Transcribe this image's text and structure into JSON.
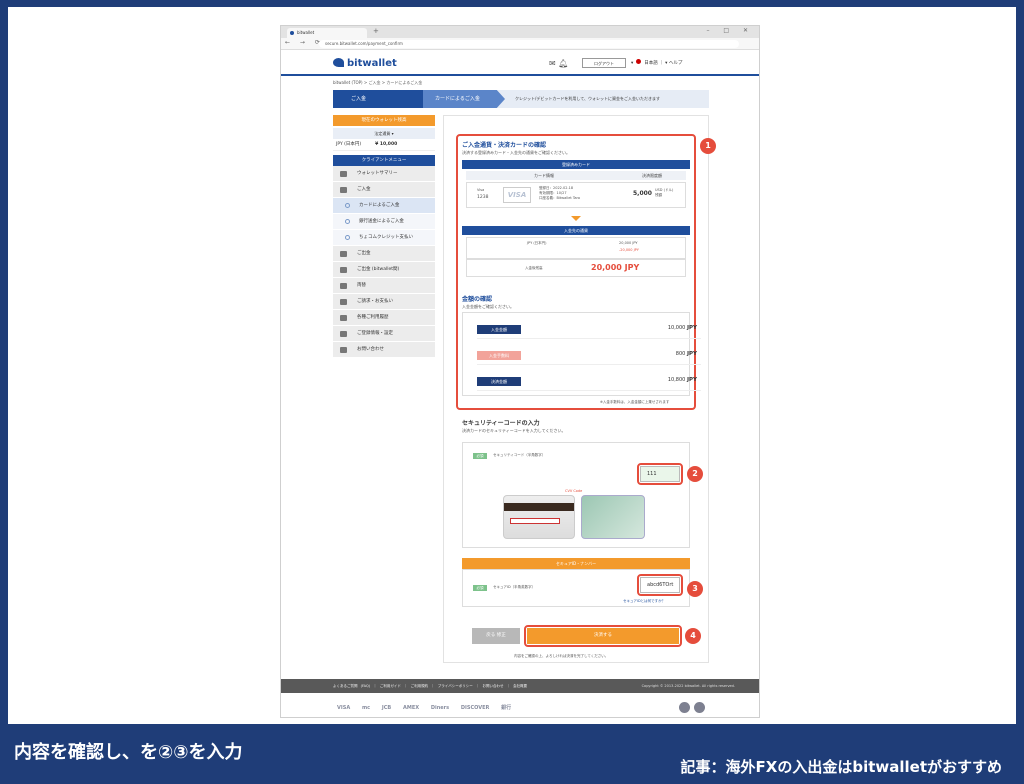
{
  "browser": {
    "tab_title": "bitwallet",
    "url": "secure.bitwallet.com/payment_confirm",
    "new_tab_icon": "plus-icon"
  },
  "header": {
    "logo": "bitwallet",
    "logout": "ログアウト",
    "language": "日本語",
    "help": "ヘルプ"
  },
  "breadcrumb": "bitwallet (TOP)  >  ご入金  >  カードによるご入金",
  "steps": {
    "step1": "ご入金",
    "step2": "カードによるご入金",
    "description": "クレジット/デビットカードを利用して、ウォレットに資金をご入金いただきます"
  },
  "sidebar": {
    "balance_header": "現在のウォレット残高",
    "currency_select": "法定通貨",
    "balance_currency": "JPY (日本円)",
    "balance_value": "¥ 10,000",
    "menu_header": "クライアントメニュー",
    "items": [
      {
        "label": "ウォレットサマリー",
        "icon": "wallet-icon",
        "sub": false
      },
      {
        "label": "ご入金",
        "icon": "deposit-icon",
        "sub": false
      },
      {
        "label": "カードによるご入金",
        "icon": "circle-icon",
        "sub": true,
        "active": true
      },
      {
        "label": "銀行送金によるご入金",
        "icon": "circle-icon",
        "sub": true
      },
      {
        "label": "ちょコムクレジット支払い",
        "icon": "circle-icon",
        "sub": true
      },
      {
        "label": "ご出金",
        "icon": "withdraw-icon",
        "sub": false
      },
      {
        "label": "ご出金 (bitwallet間)",
        "icon": "transfer-icon",
        "sub": false
      },
      {
        "label": "両替",
        "icon": "exchange-icon",
        "sub": false
      },
      {
        "label": "ご請求・お支払い",
        "icon": "invoice-icon",
        "sub": false
      },
      {
        "label": "各種ご利用履歴",
        "icon": "history-icon",
        "sub": false
      },
      {
        "label": "ご登録情報・設定",
        "icon": "settings-icon",
        "sub": false
      },
      {
        "label": "お問い合わせ",
        "icon": "help-icon",
        "sub": false
      }
    ]
  },
  "confirm": {
    "title": "ご入金通貨・決済カードの確認",
    "subtitle": "決済する登録済みカード・入金先の通貨をご確認ください。",
    "registered_card_header": "登録済みカード",
    "card_info_col": "カード情報",
    "limit_col": "決済限度額",
    "card_type": "Visa",
    "card_last4": "1238",
    "card_brand": "VISA",
    "card_details": "登録日：2022.02.18\n有効期限：10/27\n口座名義：Bitwallet Taro",
    "card_limit": "5,000",
    "card_limit_unit": "USD (ドル)\n残額",
    "deposit_currency_header": "入金先の通貨",
    "deposit_currency": "JPY (日本円)",
    "deposit_jpy1": "20,000 JPY",
    "deposit_jpy2": "-20,000 JPY",
    "deposit_total_label": "入金後残高",
    "deposit_total": "20,000 JPY"
  },
  "amount": {
    "title": "金額の確認",
    "subtitle": "入金金額をご確認ください。",
    "rows": [
      {
        "label": "入金金額",
        "value": "10,000",
        "unit": "JPY",
        "color": "#1f3d78"
      },
      {
        "label": "入金手数料",
        "value": "800",
        "unit": "JPY",
        "color": "#f2a39a"
      },
      {
        "label": "決済金額",
        "value": "10,800",
        "unit": "JPY",
        "color": "#1f3d78"
      }
    ],
    "note": "※入金手数料は、入金金額に上乗せされます"
  },
  "security": {
    "title": "セキュリティーコードの入力",
    "subtitle": "決済カードのセキュリティーコードを入力してください。",
    "required": "必須",
    "field_label": "セキュリティコード（半角数字）",
    "field_value": "111",
    "cvv_label": "CVV Code"
  },
  "secure_id": {
    "header": "セキュアID・ナンバー",
    "required": "必須",
    "field_label": "セキュアID（半角英数字）",
    "field_value": "abcd6TOrt",
    "help_link": "セキュアIDとは何ですか？"
  },
  "buttons": {
    "back": "戻る 修正",
    "confirm": "決済する",
    "note": "内容をご確認の上、よろしければ決済を完了してください。"
  },
  "badges": [
    "1",
    "2",
    "3",
    "4"
  ],
  "footer": {
    "links": "よくあるご質問 (FAQ) ｜ ご利用ガイド ｜ ご利用規約 ｜ プライバシーポリシー ｜ お問い合わせ ｜ 会社概要",
    "copyright": "Copyright © 2013-2022 bitwallet. All rights reserved.",
    "payment_logos": [
      "VISA",
      "mc",
      "JCB",
      "AMEX",
      "Diners",
      "DISCOVER",
      "銀行"
    ]
  },
  "caption": {
    "left": "内容を確認し、を②③を入力",
    "right": "記事：海外FXの入出金はbitwalletがおすすめ"
  }
}
